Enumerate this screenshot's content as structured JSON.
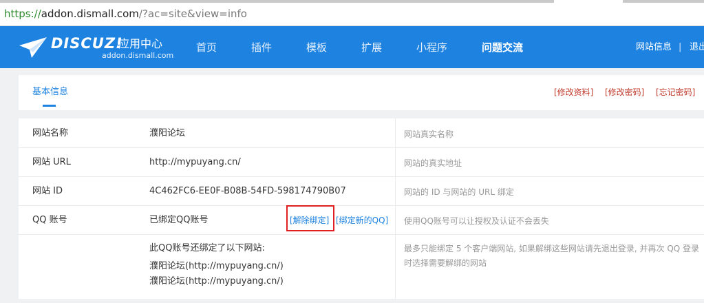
{
  "browser": {
    "url_scheme": "https://",
    "url_host": "addon.dismall.com",
    "url_rest": "/?ac=site&view=info"
  },
  "header": {
    "logo_word": "DISCUZ!",
    "logo_sub": "应用中心",
    "logo_domain": "addon.dismall.com",
    "nav": [
      {
        "label": "首页"
      },
      {
        "label": "插件"
      },
      {
        "label": "模板"
      },
      {
        "label": "扩展"
      },
      {
        "label": "小程序"
      },
      {
        "label": "问题交流"
      }
    ],
    "site_info": "网站信息",
    "separator": "|",
    "logout": "退出"
  },
  "tabs": {
    "basic": "基本信息",
    "edit_profile": "[修改资料]",
    "change_password": "[修改密码]",
    "forgot_password": "[忘记密码]"
  },
  "info": {
    "site_name": {
      "label": "网站名称",
      "value": "濮阳论坛",
      "desc": "网站真实名称"
    },
    "site_url": {
      "label": "网站 URL",
      "value": "http://mypuyang.cn/",
      "desc": "网站的真实地址"
    },
    "site_id": {
      "label": "网站 ID",
      "value": "4C462FC6-EE0F-B08B-54FD-598174790B07",
      "desc": "网站的 ID 与网站的 URL 绑定"
    },
    "qq": {
      "label": "QQ 账号",
      "value": "已绑定QQ账号",
      "unbind": "[解除绑定]",
      "bind_new": "[绑定新的QQ]",
      "desc": "使用QQ账号可以让授权及认证不会丢失"
    },
    "bound_sites": {
      "heading": "此QQ账号还绑定了以下网站:",
      "sites": [
        "濮阳论坛(http://mypuyang.cn/)",
        "濮阳论坛(http://mypuyang.cn/)"
      ],
      "desc": "最多只能绑定 5 个客户端网站, 如果解绑这些网站请先退出登录, 并再次 QQ 登录时选择需要解绑的网站"
    }
  },
  "colors": {
    "brand_blue": "#1e83e0",
    "link_red": "#c0392b",
    "highlight_red": "#e02020"
  }
}
